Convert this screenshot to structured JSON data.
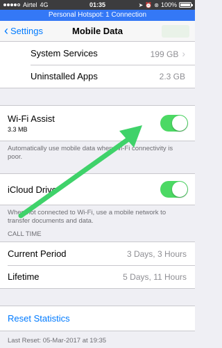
{
  "status_bar": {
    "carrier": "Airtel",
    "network": "4G",
    "time": "01:35",
    "battery": "100%",
    "battery_level": 1.0,
    "signal_bars_filled": 4,
    "signal_bars_total": 5
  },
  "hotspot_banner": "Personal Hotspot: 1 Connection",
  "nav": {
    "back_label": "Settings",
    "title": "Mobile Data"
  },
  "usage_rows": [
    {
      "label": "System Services",
      "value": "199 GB"
    },
    {
      "label": "Uninstalled Apps",
      "value": "2.3 GB"
    }
  ],
  "wifi_assist": {
    "label": "Wi-Fi Assist",
    "usage": "3.3 MB",
    "enabled": true,
    "footnote": "Automatically use mobile data when Wi-Fi connectivity is poor."
  },
  "icloud_drive": {
    "label": "iCloud Drive",
    "enabled": true,
    "footnote": "When not connected to Wi-Fi, use a mobile network to transfer documents and data."
  },
  "call_time": {
    "header": "CALL TIME",
    "rows": [
      {
        "label": "Current Period",
        "value": "3 Days, 3 Hours"
      },
      {
        "label": "Lifetime",
        "value": "5 Days, 11 Hours"
      }
    ]
  },
  "reset": {
    "label": "Reset Statistics",
    "last_reset": "Last Reset: 05-Mar-2017 at 19:35"
  },
  "colors": {
    "accent": "#007aff",
    "toggle_on": "#4cd964",
    "hotspot": "#3478f6",
    "annotation_arrow": "#3fd26a"
  }
}
